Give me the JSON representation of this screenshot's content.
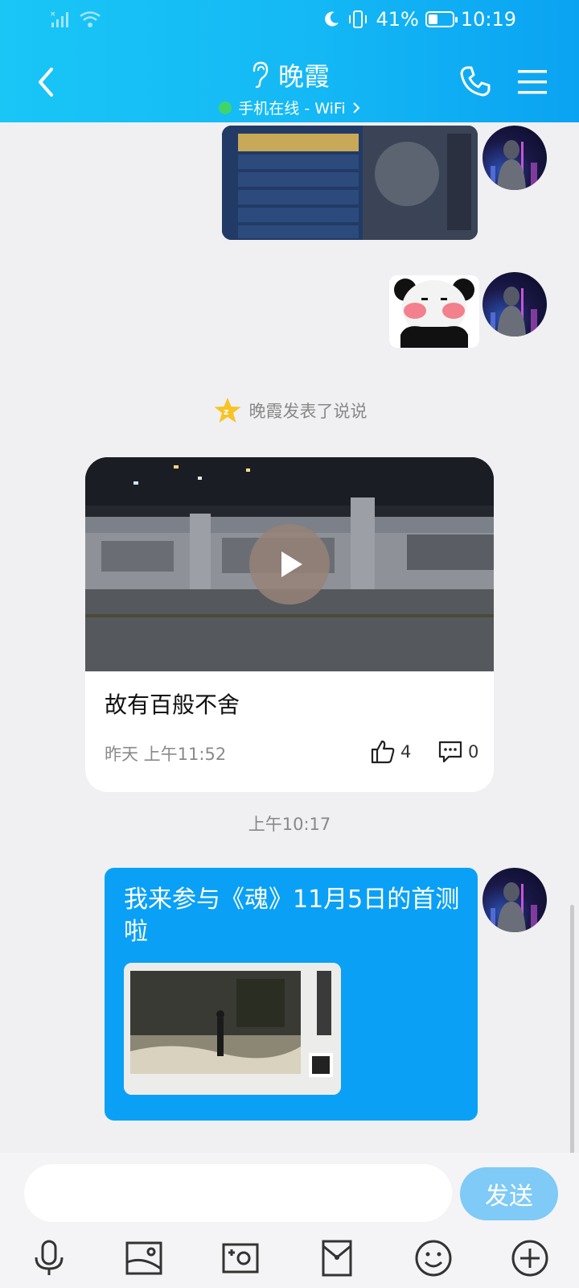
{
  "status_bar": {
    "battery": "41%",
    "time": "10:19",
    "battery_level": 0.41
  },
  "header": {
    "title": "晚霞",
    "status": "手机在线 - WiFi"
  },
  "system_note": "晚霞发表了说说",
  "post": {
    "text": "故有百般不舍",
    "time": "昨天 上午11:52",
    "likes": "4",
    "comments": "0"
  },
  "timestamp": "上午10:17",
  "message": {
    "text": "我来参与《魂》11月5日的首测啦"
  },
  "input": {
    "placeholder": "",
    "send_label": "发送"
  },
  "colors": {
    "header": "#14b8f5",
    "bubble": "#0aa0f6",
    "send": "#7fcaf6",
    "online": "#3fd56b"
  },
  "toolbar_icons": [
    "microphone-icon",
    "image-icon",
    "camera-icon",
    "red-packet-icon",
    "emoji-icon",
    "plus-icon"
  ]
}
